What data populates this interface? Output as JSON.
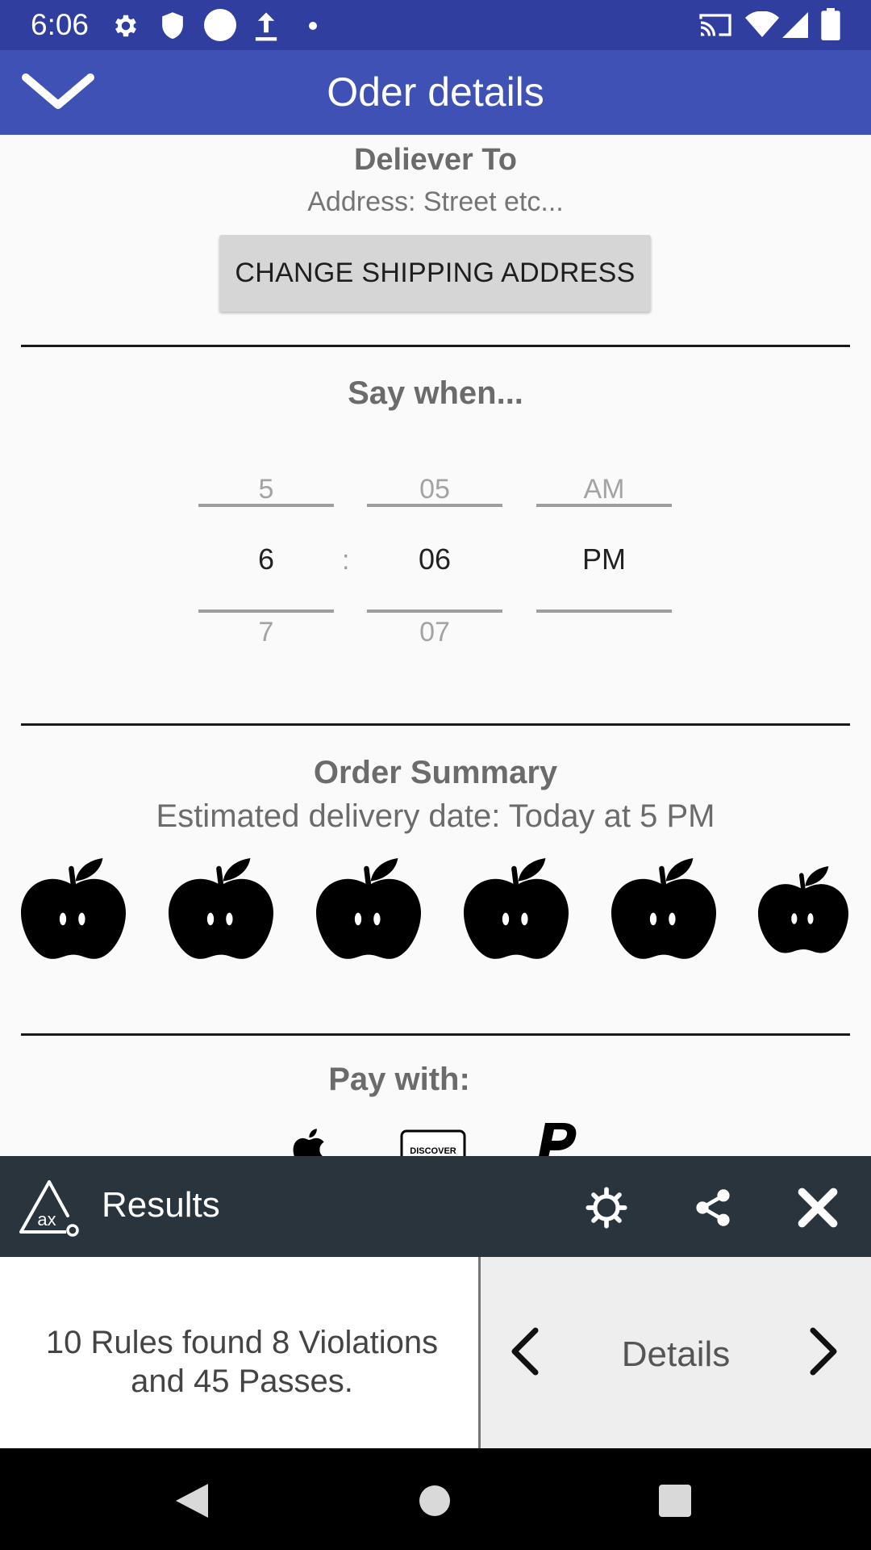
{
  "status_bar": {
    "time": "6:06",
    "icons": [
      "settings-icon",
      "shield-icon",
      "circle-icon",
      "upload-icon",
      "dot-icon",
      "cast-icon",
      "wifi-icon",
      "signal-icon",
      "battery-icon"
    ]
  },
  "app_bar": {
    "title": "Oder details",
    "collapse_icon": "chevron-down-icon"
  },
  "deliver": {
    "title": "Deliever To",
    "address": "Address: Street etc...",
    "change_button_label": "CHANGE SHIPPING ADDRESS"
  },
  "time_picker": {
    "title": "Say when...",
    "separator": ":",
    "hour": {
      "prev": "5",
      "current": "6",
      "next": "7"
    },
    "minute": {
      "prev": "05",
      "current": "06",
      "next": "07"
    },
    "ampm": {
      "prev": "AM",
      "current": "PM",
      "next": ""
    }
  },
  "order_summary": {
    "title": "Order Summary",
    "delivery_date": "Estimated delivery date: Today at 5 PM",
    "item_count": 6,
    "item_icon": "apple-icon"
  },
  "payment": {
    "title": "Pay with:",
    "methods": [
      "apple-pay-icon",
      "discover-card-icon",
      "paypal-icon"
    ],
    "discover_text": "DISCOVER"
  },
  "results_bar": {
    "title": "Results",
    "icons": [
      "axe-logo-icon",
      "settings-icon",
      "share-icon",
      "close-icon"
    ]
  },
  "results": {
    "summary": "10 Rules found 8 Violations and 45 Passes.",
    "details_label": "Details"
  },
  "nav_bar": {
    "buttons": [
      "back-icon",
      "home-icon",
      "recents-icon"
    ]
  },
  "colors": {
    "status_bar": "#303f9f",
    "app_bar": "#3f51b5",
    "results_bar": "#29343d",
    "background": "#fafafa"
  }
}
